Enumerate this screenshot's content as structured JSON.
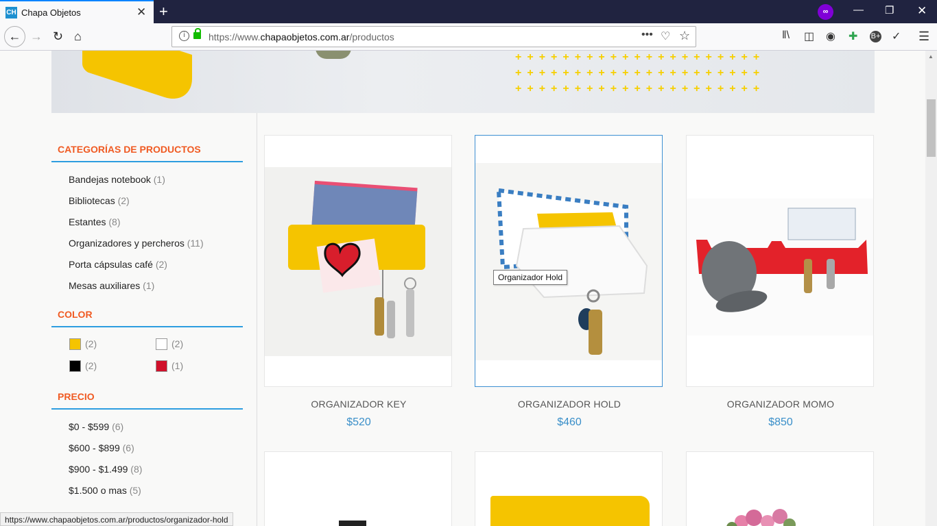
{
  "browser": {
    "tab_title": "Chapa Objetos",
    "tab_favicon": "CH",
    "tab_close": "✕",
    "new_tab": "+",
    "private_icon": "∞",
    "url_prefix": "https://www.",
    "url_domain": "chapaobjetos.com.ar",
    "url_path": "/productos",
    "url_more": "•••",
    "url_info": "i",
    "toolbar_icons": [
      "library-icon",
      "sidebar-icon",
      "sync-icon",
      "extension-icon",
      "badge-icon",
      "check-icon",
      "menu-icon"
    ]
  },
  "sidebar": {
    "categories_heading": "CATEGORÍAS DE PRODUCTOS",
    "categories": [
      {
        "label": "Bandejas notebook",
        "count": "(1)"
      },
      {
        "label": "Bibliotecas",
        "count": "(2)"
      },
      {
        "label": "Estantes",
        "count": "(8)"
      },
      {
        "label": "Organizadores y percheros",
        "count": "(11)"
      },
      {
        "label": "Porta cápsulas café",
        "count": "(2)"
      },
      {
        "label": "Mesas auxiliares",
        "count": "(1)"
      }
    ],
    "color_heading": "COLOR",
    "colors": [
      {
        "hex": "#f5c400",
        "count": "(2)"
      },
      {
        "hex": "#ffffff",
        "count": "(2)"
      },
      {
        "hex": "#000000",
        "count": "(2)"
      },
      {
        "hex": "#d0102a",
        "count": "(1)"
      }
    ],
    "price_heading": "PRECIO",
    "prices": [
      {
        "label": "$0 - $599",
        "count": "(6)"
      },
      {
        "label": "$600 - $899",
        "count": "(6)"
      },
      {
        "label": "$900 - $1.499",
        "count": "(8)"
      },
      {
        "label": "$1.500 o mas",
        "count": "(5)"
      }
    ]
  },
  "products": [
    {
      "name": "ORGANIZADOR KEY",
      "price": "$520",
      "color": "#f5c400"
    },
    {
      "name": "ORGANIZADOR HOLD",
      "price": "$460",
      "color": "#ffffff"
    },
    {
      "name": "ORGANIZADOR MOMO",
      "price": "$850",
      "color": "#e3222a"
    }
  ],
  "tooltip": "Organizador Hold",
  "status_url": "https://www.chapaobjetos.com.ar/productos/organizador-hold"
}
